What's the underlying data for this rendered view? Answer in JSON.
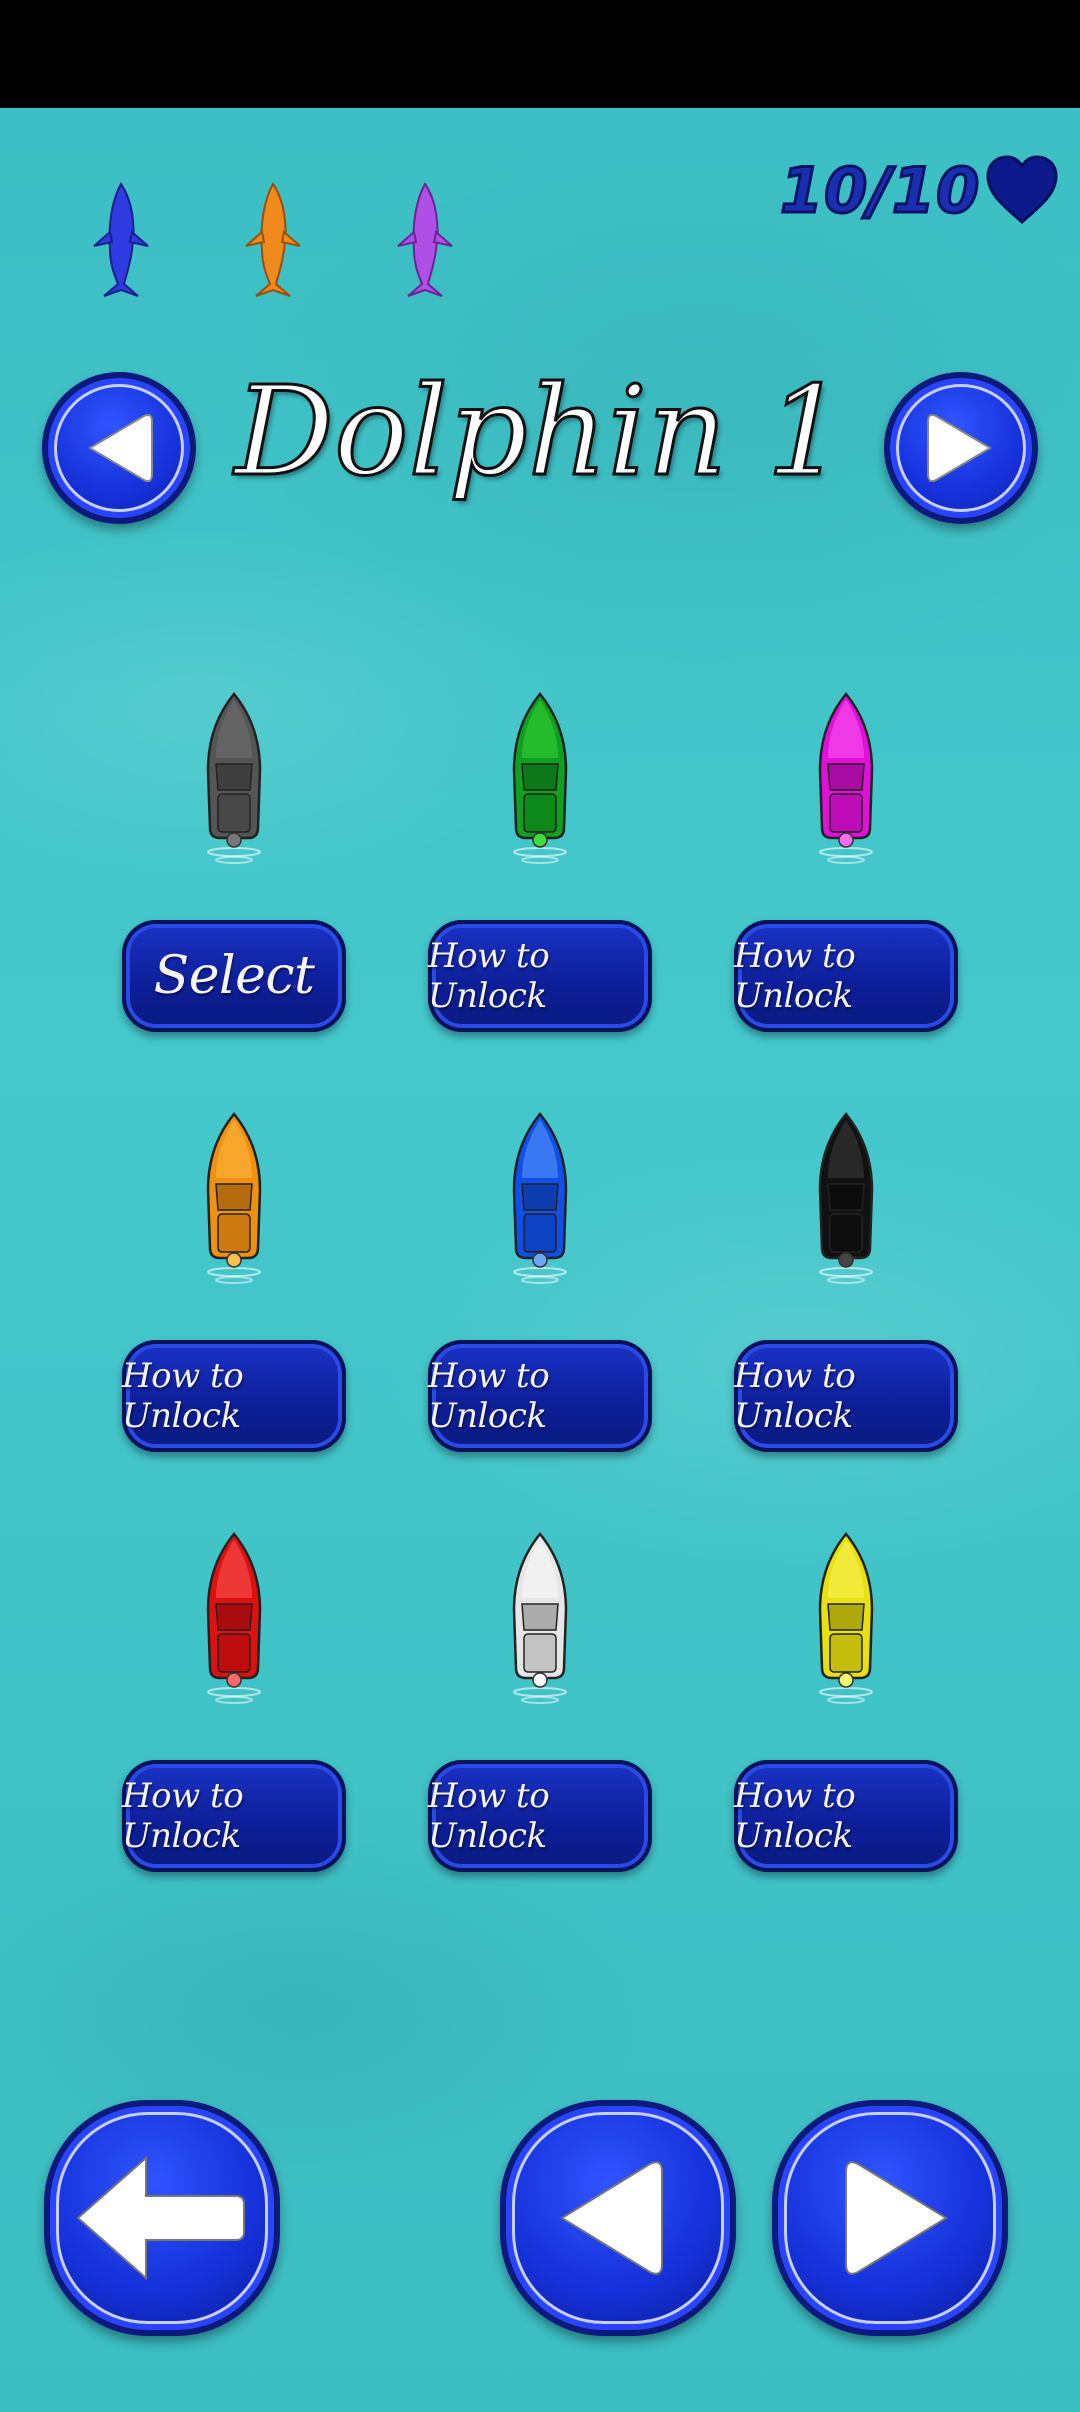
{
  "lives": {
    "text": "10/10"
  },
  "title": "Dolphin 1",
  "dolphins": [
    {
      "name": "blue",
      "color": "#2f3ae0"
    },
    {
      "name": "orange",
      "color": "#f08a1c"
    },
    {
      "name": "purple",
      "color": "#b04fe6"
    }
  ],
  "boats": [
    {
      "color": "#555555",
      "light": "#777777",
      "button": "Select"
    },
    {
      "color": "#10a020",
      "light": "#3fdc3f",
      "button": "How to Unlock"
    },
    {
      "color": "#e010d8",
      "light": "#ff6cf5",
      "button": "How to Unlock"
    },
    {
      "color": "#f09010",
      "light": "#ffc050",
      "button": "How to Unlock"
    },
    {
      "color": "#1050e8",
      "light": "#6aa8ff",
      "button": "How to Unlock"
    },
    {
      "color": "#111111",
      "light": "#444444",
      "button": "How to Unlock"
    },
    {
      "color": "#e01010",
      "light": "#ff6a6a",
      "button": "How to Unlock"
    },
    {
      "color": "#e6e6e6",
      "light": "#ffffff",
      "button": "How to Unlock"
    },
    {
      "color": "#e8e010",
      "light": "#fff870",
      "button": "How to Unlock"
    }
  ],
  "icons": {
    "prev": "triangle-left-icon",
    "next": "triangle-right-icon",
    "back": "arrow-left-icon",
    "heart": "heart-icon"
  }
}
